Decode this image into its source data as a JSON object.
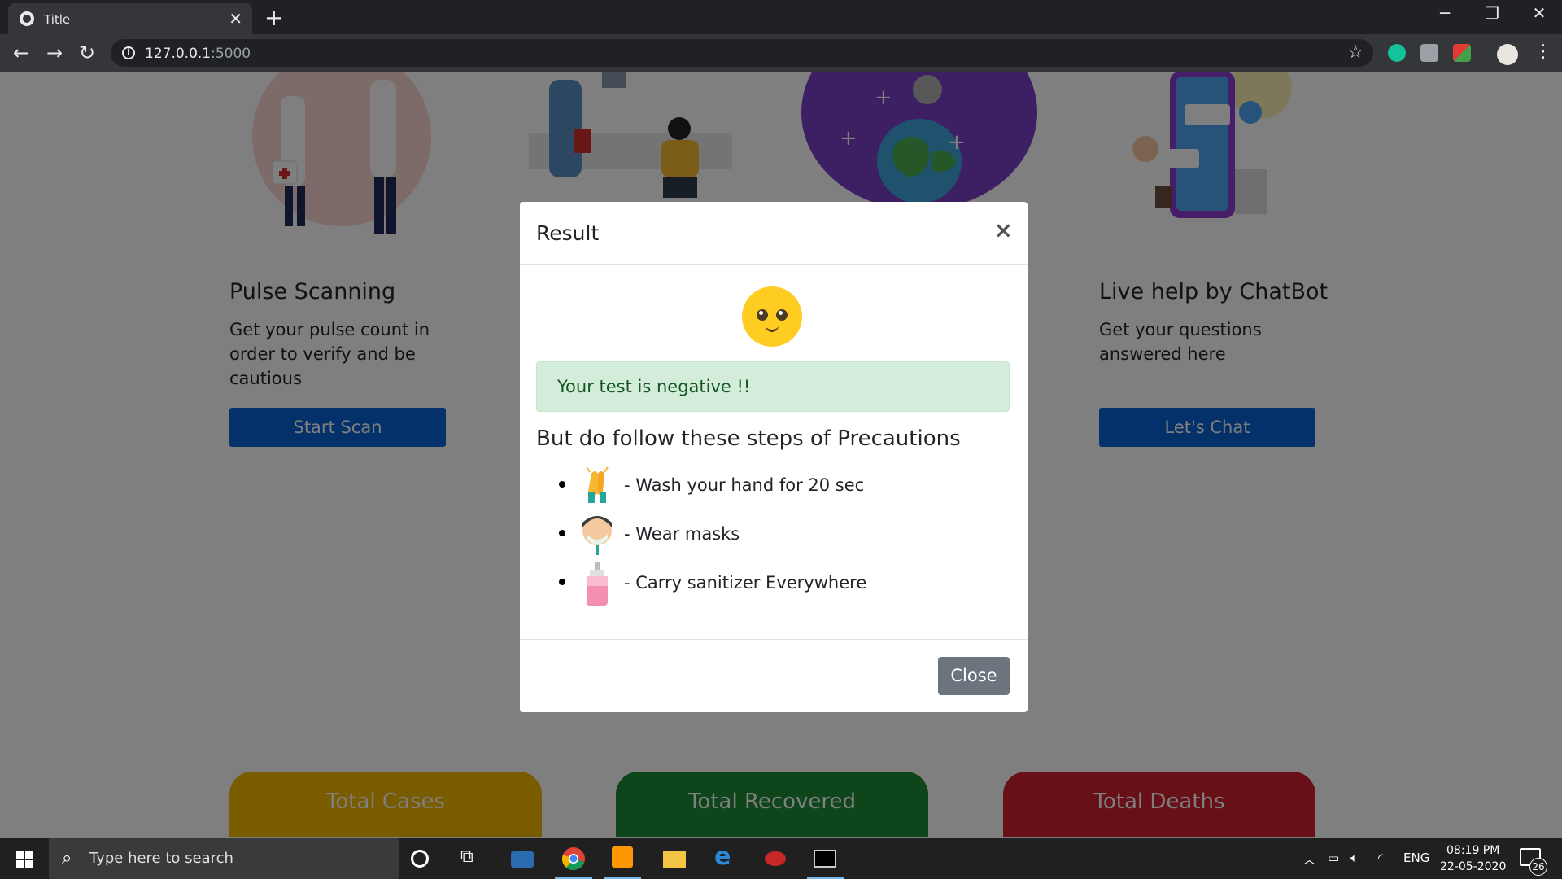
{
  "browser": {
    "tab_title": "Title",
    "url_host": "127.0.0.1",
    "url_port": ":5000"
  },
  "features": [
    {
      "title": "Pulse Scanning",
      "description": "Get your pulse count in order to verify and be cautious",
      "button": "Start Scan"
    },
    {
      "title": "Live help by ChatBot",
      "description": "Get your questions answered here",
      "button": "Let's Chat"
    }
  ],
  "stats": [
    {
      "label": "Total Cases",
      "color": "#f5b800"
    },
    {
      "label": "Total Recovered",
      "color": "#1e8a34"
    },
    {
      "label": "Total Deaths",
      "color": "#cf2030"
    }
  ],
  "modal": {
    "title": "Result",
    "close_symbol": "×",
    "alert_text": "Your test is negative !!",
    "steps_heading": "But do follow these steps of Precautions",
    "steps": [
      {
        "icon": "handwash-icon",
        "text": "- Wash your hand for 20 sec"
      },
      {
        "icon": "mask-icon",
        "text": "- Wear masks"
      },
      {
        "icon": "sanitizer-icon",
        "text": "- Carry sanitizer Everywhere"
      }
    ],
    "close_button": "Close"
  },
  "taskbar": {
    "search_placeholder": "Type here to search",
    "language": "ENG",
    "time": "08:19 PM",
    "date": "22-05-2020",
    "notification_count": "26"
  },
  "colors": {
    "primary_button": "#0a63d6",
    "alert_bg": "#d4edda",
    "alert_text": "#155724",
    "secondary_button": "#6c757d"
  }
}
